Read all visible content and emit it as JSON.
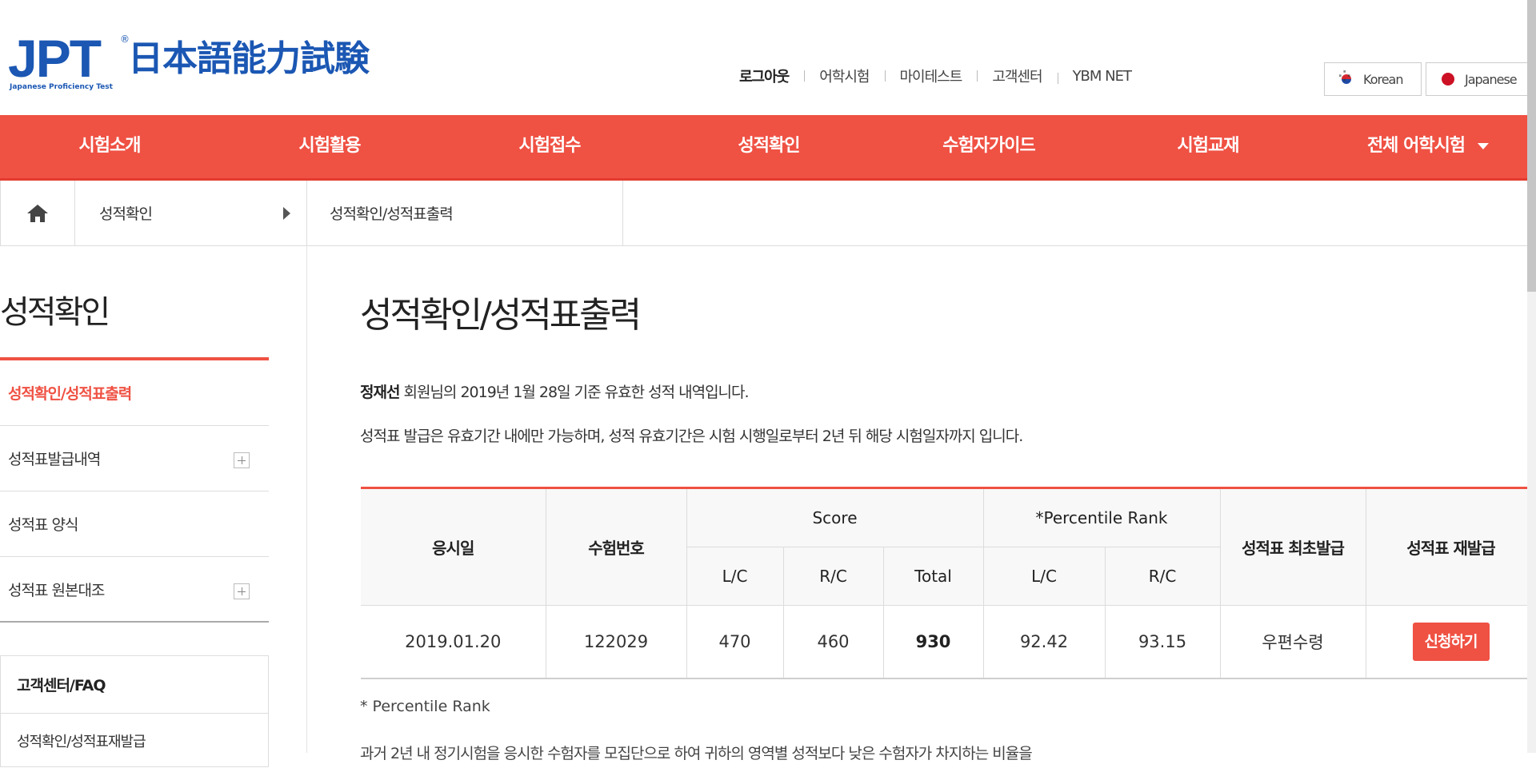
{
  "header": {
    "logo": {
      "main": "JPT",
      "reg": "®",
      "title": "日本語能力試験",
      "subtitle": "Japanese Proficiency Test"
    },
    "util_nav": [
      "로그아웃",
      "어학시험",
      "마이테스트",
      "고객센터",
      "YBM NET"
    ],
    "languages": [
      {
        "label": "Korean",
        "icon": "korea-flag-icon"
      },
      {
        "label": "Japanese",
        "icon": "japan-flag-icon"
      }
    ]
  },
  "gnb": {
    "items": [
      "시험소개",
      "시험활용",
      "시험접수",
      "성적확인",
      "수험자가이드",
      "시험교재",
      "전체 어학시험"
    ]
  },
  "breadcrumb": {
    "home_icon": "home-icon",
    "level1": "성적확인",
    "level2": "성적확인/성적표출력"
  },
  "sidebar": {
    "title": "성적확인",
    "items": [
      {
        "label": "성적확인/성적표출력",
        "active": true
      },
      {
        "label": "성적표발급내역",
        "expandable": true
      },
      {
        "label": "성적표 양식"
      },
      {
        "label": "성적표 원본대조",
        "expandable": true
      }
    ],
    "faq": {
      "title": "고객센터/FAQ",
      "link": "성적확인/성적표재발급"
    }
  },
  "main": {
    "title": "성적확인/성적표출력",
    "notice_name": "정재선",
    "notice_text": " 회원님의 2019년 1월 28일 기준 유효한 성적 내역입니다.",
    "notice2": "성적표 발급은 유효기간 내에만 가능하며, 성적 유효기간은 시험 시행일로부터 2년 뒤 해당 시험일자까지 입니다.",
    "table": {
      "headers": {
        "date": "응시일",
        "exam_no": "수험번호",
        "score": "Score",
        "percentile": "*Percentile Rank",
        "first_issue": "성적표 최초발급",
        "reissue": "성적표 재발급",
        "lc": "L/C",
        "rc": "R/C",
        "total": "Total",
        "p_lc": "L/C",
        "p_rc": "R/C"
      },
      "rows": [
        {
          "date": "2019.01.20",
          "exam_no": "122029",
          "lc": "470",
          "rc": "460",
          "total": "930",
          "p_lc": "92.42",
          "p_rc": "93.15",
          "first_issue": "우편수령",
          "reissue_button": "신청하기"
        }
      ]
    },
    "footnote": "* Percentile Rank",
    "footnote_desc": "과거 2년 내 정기시험을 응시한 수험자를 모집단으로 하여 귀하의 영역별 성적보다 낮은 수험자가 차지하는 비율을"
  },
  "colors": {
    "brand_red": "#ef5143",
    "logo_blue": "#1b57b3"
  }
}
